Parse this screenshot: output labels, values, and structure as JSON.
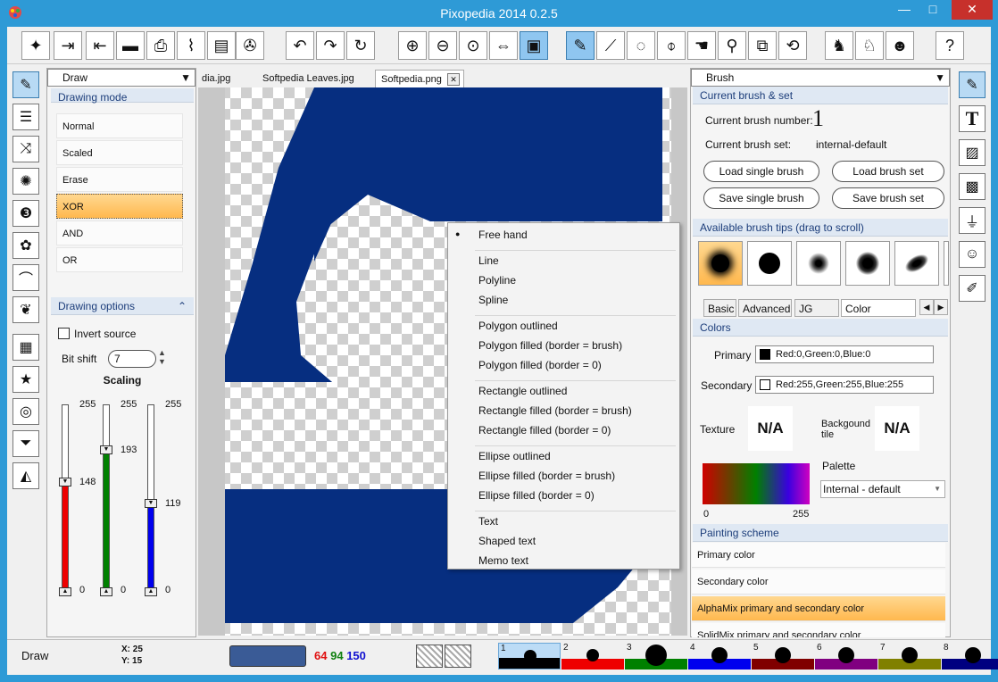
{
  "window": {
    "title": "Pixopedia 2014 0.2.5",
    "min": "—",
    "max": "□",
    "close": "✕"
  },
  "left_panel": {
    "header": "Draw",
    "drawing_mode_title": "Drawing mode",
    "modes": [
      "Normal",
      "Scaled",
      "Erase",
      "XOR",
      "AND",
      "OR"
    ],
    "selected_mode": "XOR",
    "drawing_options_title": "Drawing options",
    "invert_source": "Invert source",
    "bit_shift_label": "Bit shift",
    "bit_shift_value": "7",
    "scaling_label": "Scaling",
    "sliders": [
      {
        "color": "#ee0000",
        "top": "255",
        "value": 148,
        "bottom": "0",
        "value_label": "148"
      },
      {
        "color": "#008000",
        "top": "255",
        "value": 193,
        "bottom": "0",
        "value_label": "193"
      },
      {
        "color": "#0000ee",
        "top": "255",
        "value": 119,
        "bottom": "0",
        "value_label": "119"
      }
    ]
  },
  "tabs": [
    {
      "label": "dia.jpg"
    },
    {
      "label": "Softpedia Leaves.jpg"
    },
    {
      "label": "Softpedia.png",
      "close": "✕"
    }
  ],
  "context_menu": {
    "groups": [
      [
        "Free hand"
      ],
      [
        "Line",
        "Polyline",
        "Spline"
      ],
      [
        "Polygon outlined",
        "Polygon filled (border = brush)",
        "Polygon filled (border = 0)"
      ],
      [
        "Rectangle outlined",
        "Rectangle filled (border = brush)",
        "Rectangle filled (border = 0)"
      ],
      [
        "Ellipse outlined",
        "Ellipse filled (border = brush)",
        "Ellipse filled (border = 0)"
      ],
      [
        "Text",
        "Shaped text",
        "Memo text"
      ]
    ],
    "checked": "Free hand",
    "check_glyph": "●"
  },
  "right_panel": {
    "header": "Brush",
    "current_brush_title": "Current brush & set",
    "brush_number_label": "Current brush number:",
    "brush_number": "1",
    "brush_set_label": "Current brush set:",
    "brush_set": "internal-default",
    "buttons": {
      "load_single": "Load single brush",
      "load_set": "Load brush set",
      "save_single": "Save single brush",
      "save_set": "Save brush set"
    },
    "tips_title": "Available brush tips (drag to scroll)",
    "tabs": [
      "Basic",
      "Advanced",
      "JG rules",
      "Color sceheme"
    ],
    "active_tab": "Color sceheme",
    "tab_nav": [
      "◀",
      "▶"
    ],
    "colors_title": "Colors",
    "primary_label": "Primary",
    "primary_value": "Red:0,Green:0,Blue:0",
    "secondary_label": "Secondary",
    "secondary_value": "Red:255,Green:255,Blue:255",
    "texture_label": "Texture",
    "texture_value": "N/A",
    "background_tile_label": "Backgound tile",
    "background_tile_value": "N/A",
    "palette_label": "Palette",
    "palette_value": "Internal - default",
    "gradient_min": "0",
    "gradient_max": "255",
    "painting_scheme_title": "Painting scheme",
    "schemes": [
      "Primary color",
      "Secondary color",
      "AlphaMix primary and secondary color",
      "SolidMix primary and secondary color"
    ],
    "selected_scheme": "AlphaMix primary and secondary color"
  },
  "status": {
    "mode": "Draw",
    "x_label": "X:",
    "x": "25",
    "y_label": "Y:",
    "y": "15",
    "swatch_color": "#3a5b96",
    "r": "64",
    "g": "94",
    "b": "150",
    "brush_slots": [
      {
        "num": "1",
        "color": "#000000"
      },
      {
        "num": "2",
        "color": "#ee0000"
      },
      {
        "num": "3",
        "color": "#008000"
      },
      {
        "num": "4",
        "color": "#0000ee"
      },
      {
        "num": "5",
        "color": "#800000"
      },
      {
        "num": "6",
        "color": "#800080"
      },
      {
        "num": "7",
        "color": "#808000"
      },
      {
        "num": "8",
        "color": "#000080"
      }
    ]
  },
  "colors": {
    "canvas_blue": "#062e80",
    "accent": "#2e9ad6",
    "highlight": "#ffb84e"
  }
}
